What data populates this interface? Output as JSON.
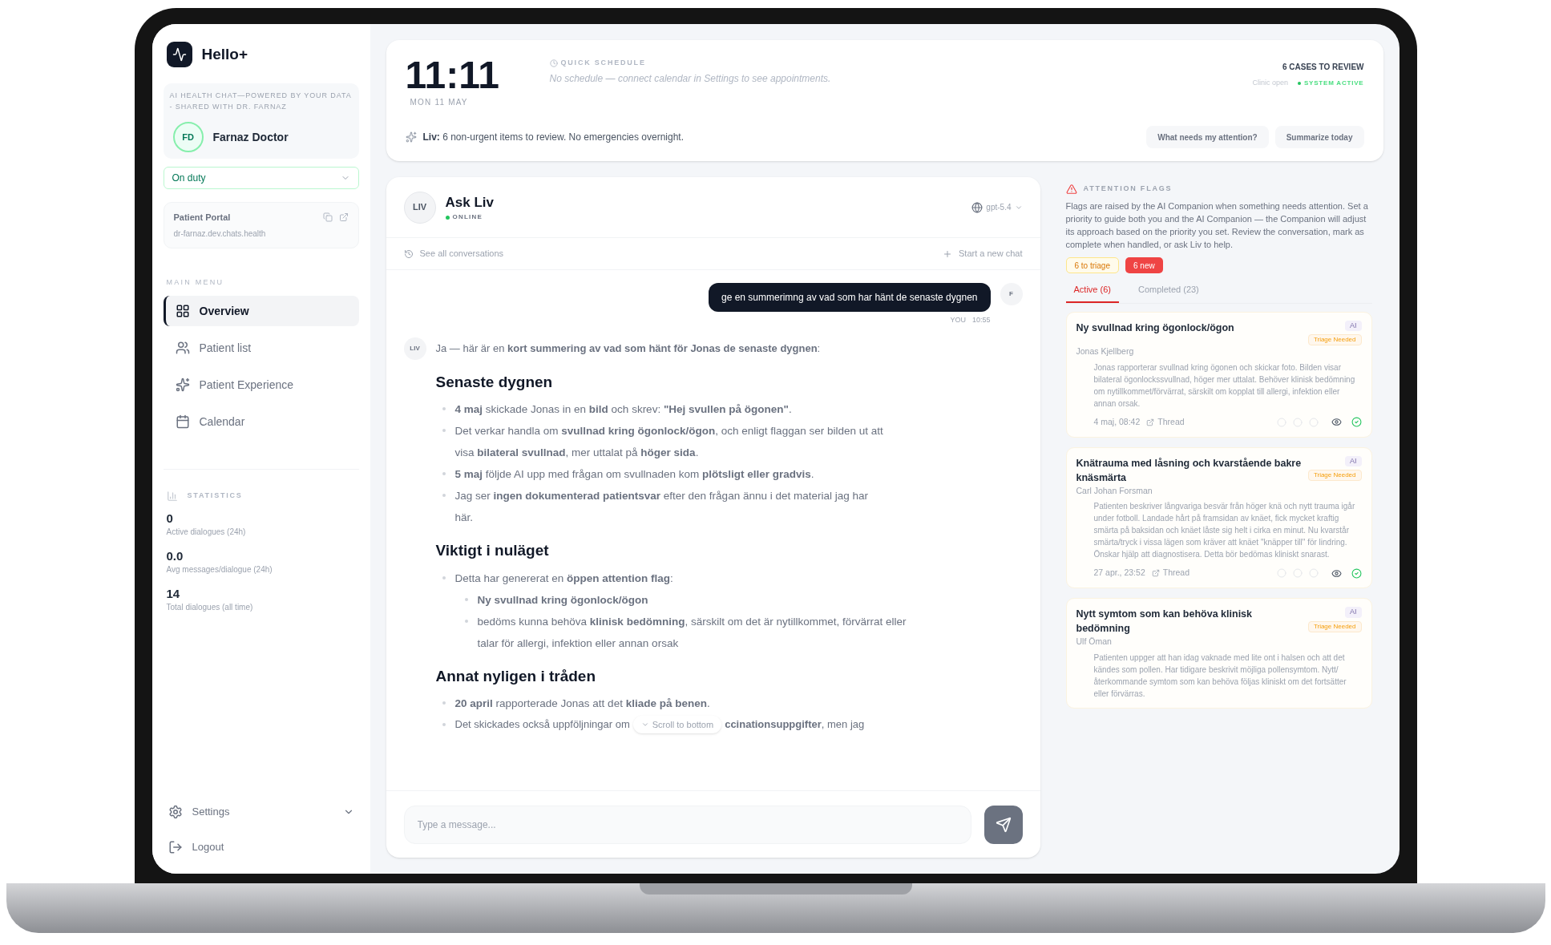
{
  "brand": {
    "name": "Hello+"
  },
  "sidebar": {
    "tagline": "AI HEALTH CHAT—POWERED BY YOUR DATA - SHARED WITH DR. FARNAZ",
    "user": {
      "initials": "FD",
      "name": "Farnaz Doctor"
    },
    "duty_select": {
      "value": "On duty"
    },
    "portal": {
      "title": "Patient Portal",
      "url": "dr-farnaz.dev.chats.health"
    },
    "menu_title": "MAIN MENU",
    "menu": [
      {
        "label": "Overview",
        "selected": true
      },
      {
        "label": "Patient list",
        "selected": false
      },
      {
        "label": "Patient Experience",
        "selected": false
      },
      {
        "label": "Calendar",
        "selected": false
      }
    ],
    "stats_title": "STATISTICS",
    "stats": [
      {
        "value": "0",
        "label": "Active dialogues (24h)"
      },
      {
        "value": "0.0",
        "label": "Avg messages/dialogue (24h)"
      },
      {
        "value": "14",
        "label": "Total dialogues (all time)"
      }
    ],
    "bottom": [
      {
        "label": "Settings"
      },
      {
        "label": "Logout"
      }
    ]
  },
  "header": {
    "time": "11:11",
    "date": "MON 11 MAY",
    "schedule_title": "QUICK SCHEDULE",
    "schedule_text": "No schedule — connect calendar in Settings to see appointments.",
    "cases": "6 CASES TO REVIEW",
    "clinic": "Clinic open",
    "system": "SYSTEM ACTIVE",
    "liv_label": "Liv:",
    "liv_text": "6 non-urgent items to review. No emergencies overnight.",
    "buttons": [
      "What needs my attention?",
      "Summarize today"
    ]
  },
  "chat": {
    "avatar": "LIV",
    "title": "Ask Liv",
    "status": "ONLINE",
    "model": "gpt-5.4",
    "see_all": "See all conversations",
    "new_chat": "Start a new chat",
    "user_message": {
      "avatar": "F",
      "text": "ge en summerimng av vad som har hänt de senaste dygnen",
      "sender": "YOU",
      "time": "10:55"
    },
    "reply": {
      "avatar": "LIV",
      "intro": "Ja — här är en **kort summering av vad som hänt för Jonas de senaste dygnen**:",
      "sections": [
        {
          "heading": "Senaste dygnen",
          "items": [
            {
              "text": "**4 maj** skickade Jonas in en **bild** och skrev: **\"Hej svullen på ögonen\"**."
            },
            {
              "text": "Det verkar handla om **svullnad kring ögonlock/ögon**, och enligt flaggan ser bilden ut att visa **bilateral svullnad**, mer uttalat på **höger sida**."
            },
            {
              "text": "**5 maj** följde AI upp med frågan om svullnaden kom **plötsligt eller gradvis**."
            },
            {
              "text": "Jag ser **ingen dokumenterad patientsvar** efter den frågan ännu i det material jag har här."
            }
          ]
        },
        {
          "heading": "Viktigt i nuläget",
          "items": [
            {
              "text": "Detta har genererat en **öppen attention flag**:",
              "children": [
                {
                  "text": "**Ny svullnad kring ögonlock/ögon**"
                },
                {
                  "text": "bedöms kunna behöva **klinisk bedömning**, särskilt om det är nytillkommet, förvärrat eller talar för allergi, infektion eller annan orsak"
                }
              ]
            }
          ]
        },
        {
          "heading": "Annat nyligen i tråden",
          "items": [
            {
              "text": "**20 april** rapporterade Jonas att det **kliade på benen**."
            },
            {
              "text": "Det skickades också uppföljningar om",
              "text_after": "**ccinationsuppgifter**, men jag"
            }
          ]
        }
      ]
    },
    "scroll_button": "Scroll to bottom",
    "input": {
      "placeholder": "Type a message..."
    }
  },
  "flags": {
    "title": "ATTENTION FLAGS",
    "description": "Flags are raised by the AI Companion when something needs attention. Set a priority to guide both you and the AI Companion — the Companion will adjust its approach based on the priority you set. Review the conversation, mark as complete when handled, or ask Liv to help.",
    "badges": [
      {
        "label": "6 to triage",
        "kind": "outline"
      },
      {
        "label": "6 new",
        "kind": "solid"
      }
    ],
    "tabs": [
      {
        "label": "Active (6)",
        "selected": true
      },
      {
        "label": "Completed (23)",
        "selected": false
      }
    ],
    "cards": [
      {
        "title": "Ny svullnad kring ögonlock/ögon",
        "patient": "Jonas Kjellberg",
        "source": "AI",
        "status": "Triage Needed",
        "body": "Jonas rapporterar svullnad kring ögonen och skickar foto. Bilden visar bilateral ögonlockssvullnad, höger mer uttalat. Behöver klinisk bedömning om nytillkommet/förvärrat, särskilt om kopplat till allergi, infektion eller annan orsak.",
        "date": "4 maj, 08:42",
        "link": "Thread"
      },
      {
        "title": "Knätrauma med låsning och kvarstående bakre knäsmärta",
        "patient": "Carl Johan Forsman",
        "source": "AI",
        "status": "Triage Needed",
        "body": "Patienten beskriver långvariga besvär från höger knä och nytt trauma igår under fotboll. Landade hårt på framsidan av knäet, fick mycket kraftig smärta på baksidan och knäet låste sig helt i cirka en minut. Nu kvarstår smärta/tryck i vissa lägen som kräver att knäet \"knäpper till\" för lindring. Önskar hjälp att diagnostisera. Detta bör bedömas kliniskt snarast.",
        "date": "27 apr., 23:52",
        "link": "Thread"
      },
      {
        "title": "Nytt symtom som kan behöva klinisk bedömning",
        "patient": "Ulf Öman",
        "source": "AI",
        "status": "Triage Needed",
        "body": "Patienten uppger att han idag vaknade med lite ont i halsen och att det kändes som pollen. Har tidigare beskrivit möjliga pollensymtom. Nytt/återkommande symtom som kan behöva följas kliniskt om det fortsätter eller förvärras."
      }
    ]
  }
}
